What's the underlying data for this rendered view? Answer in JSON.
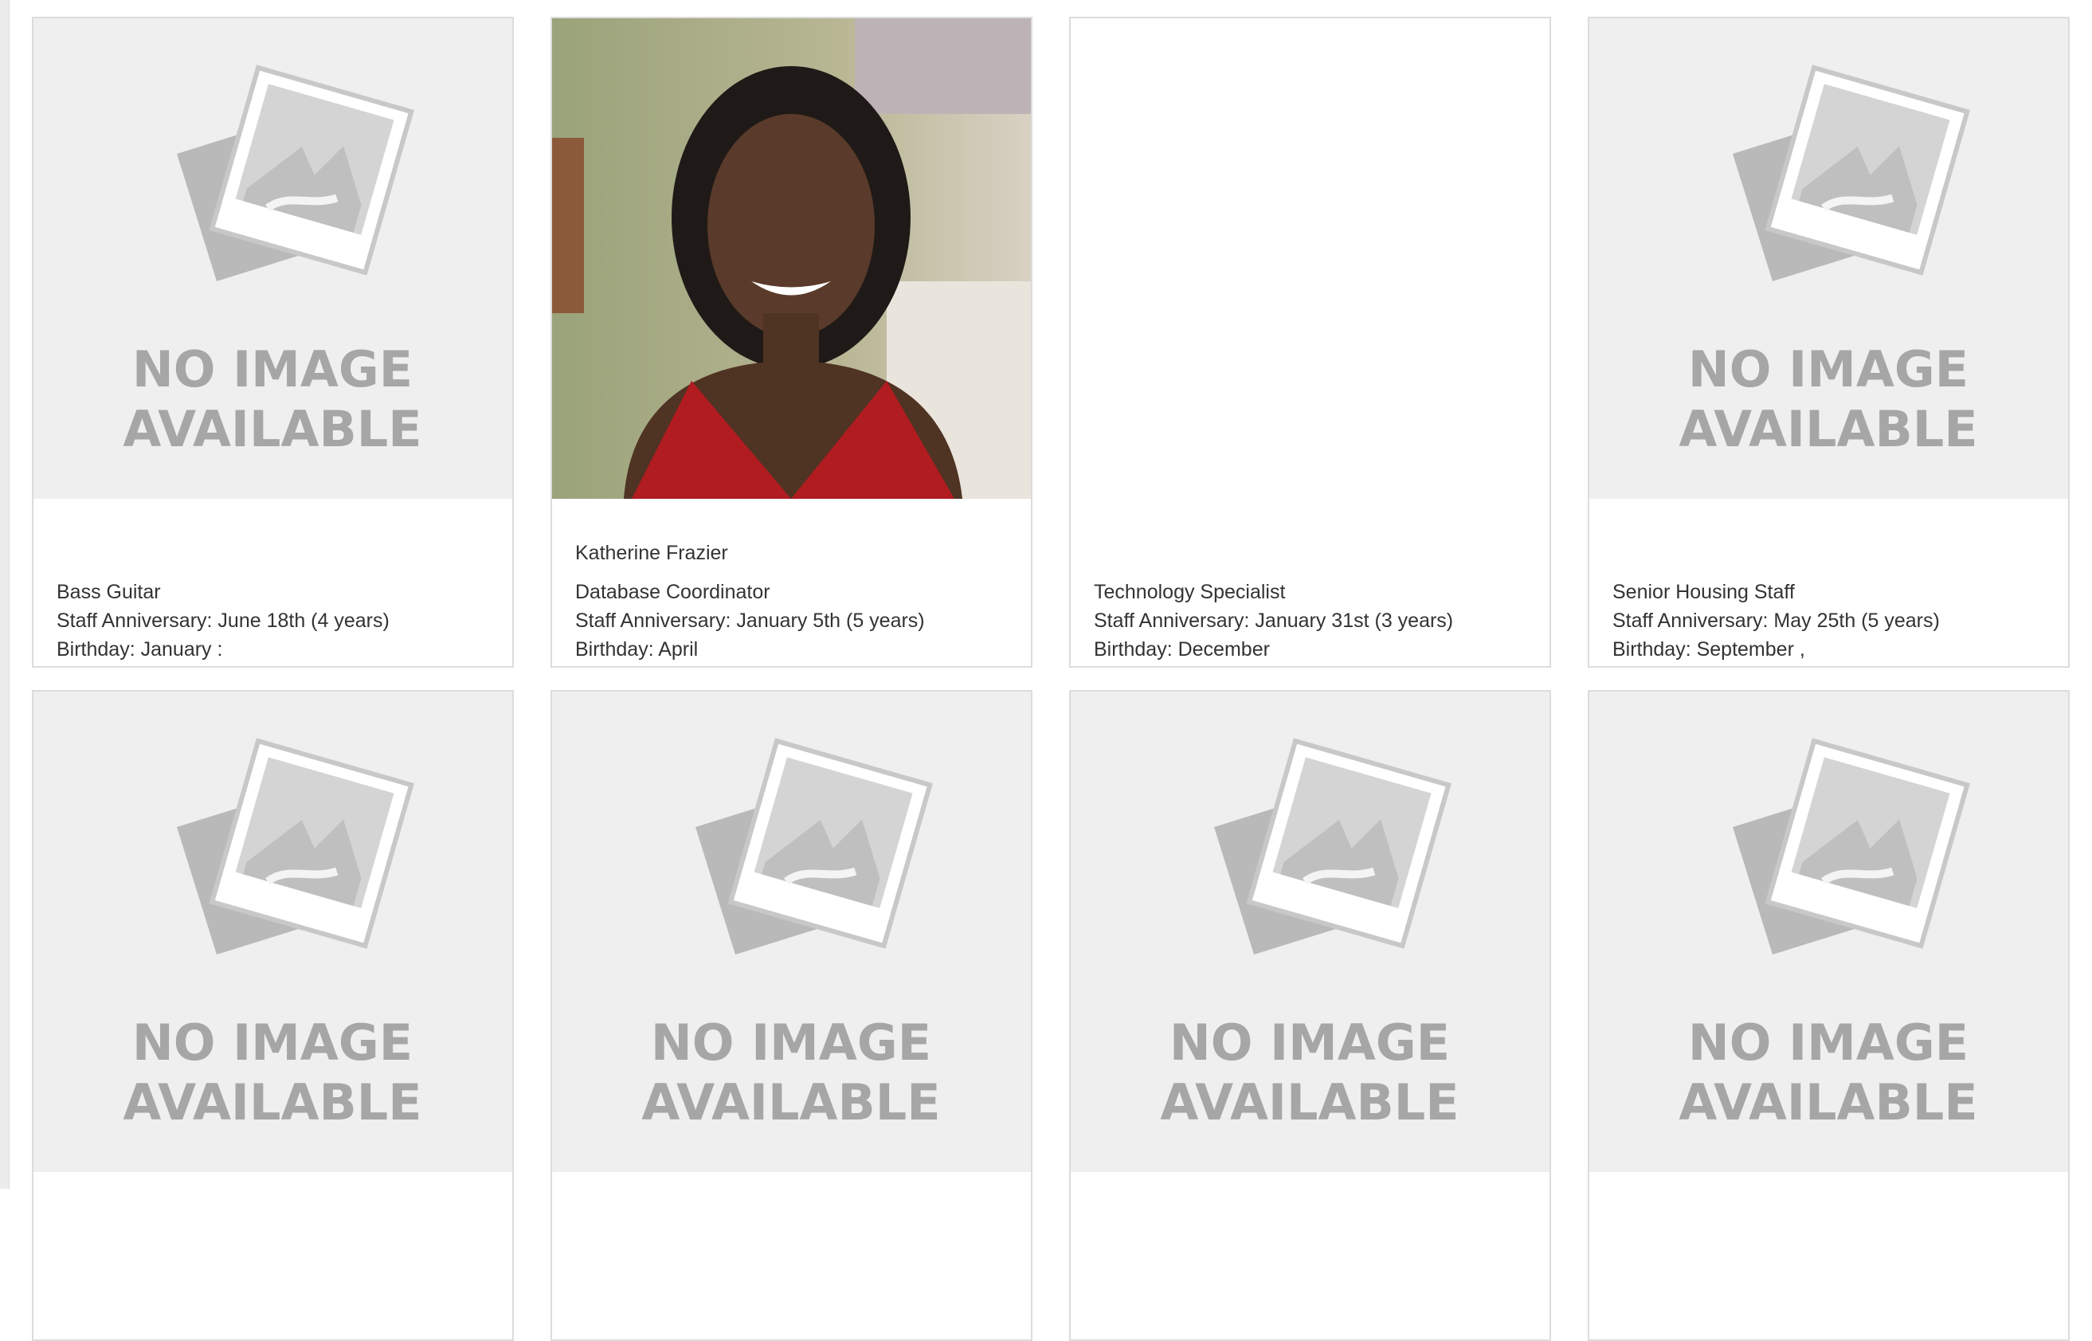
{
  "placeholder": {
    "line1": "NO IMAGE",
    "line2": "AVAILABLE"
  },
  "cards": [
    {
      "name": "",
      "title": "Bass Guitar",
      "anniversary": "Staff Anniversary: June 18th (4 years)",
      "birthday": "Birthday: January :",
      "photo": "no-image"
    },
    {
      "name": "Katherine Frazier",
      "title": "Database Coordinator",
      "anniversary": "Staff Anniversary: January 5th (5 years)",
      "birthday": "Birthday: April",
      "photo": "portrait"
    },
    {
      "name": "",
      "title": "Technology Specialist",
      "anniversary": "Staff Anniversary: January 31st (3 years)",
      "birthday": "Birthday: December",
      "photo": "blank"
    },
    {
      "name": "",
      "title": "Senior Housing Staff",
      "anniversary": "Staff Anniversary: May 25th (5 years)",
      "birthday": "Birthday: September ,",
      "photo": "no-image"
    },
    {
      "photo": "no-image"
    },
    {
      "photo": "no-image"
    },
    {
      "photo": "no-image"
    },
    {
      "photo": "no-image"
    }
  ]
}
